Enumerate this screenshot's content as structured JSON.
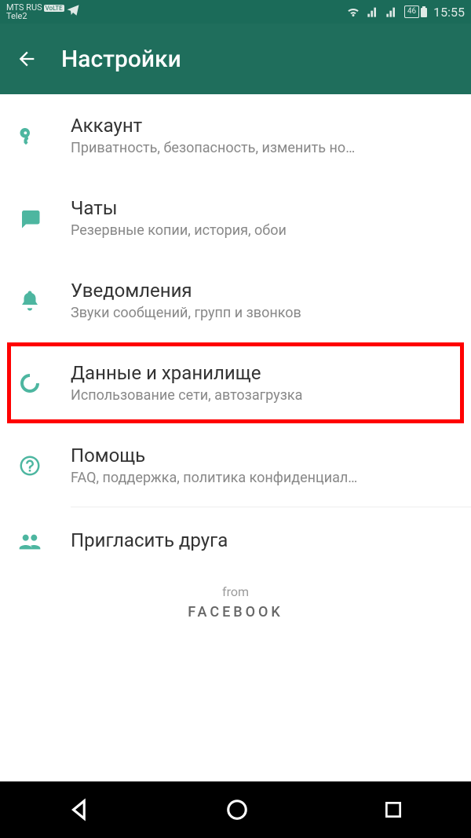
{
  "status": {
    "carrier1": "MTS RUS",
    "carrier2": "Tele2",
    "volte": "VoLTE",
    "battery": "46",
    "time": "15:55"
  },
  "header": {
    "title": "Настройки"
  },
  "items": [
    {
      "icon": "key",
      "title": "Аккаунт",
      "sub": "Приватность, безопасность, изменить но…"
    },
    {
      "icon": "chat",
      "title": "Чаты",
      "sub": "Резервные копии, история, обои"
    },
    {
      "icon": "bell",
      "title": "Уведомления",
      "sub": "Звуки сообщений, групп и звонков"
    },
    {
      "icon": "data",
      "title": "Данные и хранилище",
      "sub": "Использование сети, автозагрузка",
      "highlighted": true
    },
    {
      "icon": "help",
      "title": "Помощь",
      "sub": "FAQ, поддержка, политика конфиденциал…"
    },
    {
      "icon": "people",
      "title": "Пригласить друга",
      "sub": ""
    }
  ],
  "footer": {
    "from": "from",
    "brand": "FACEBOOK"
  }
}
